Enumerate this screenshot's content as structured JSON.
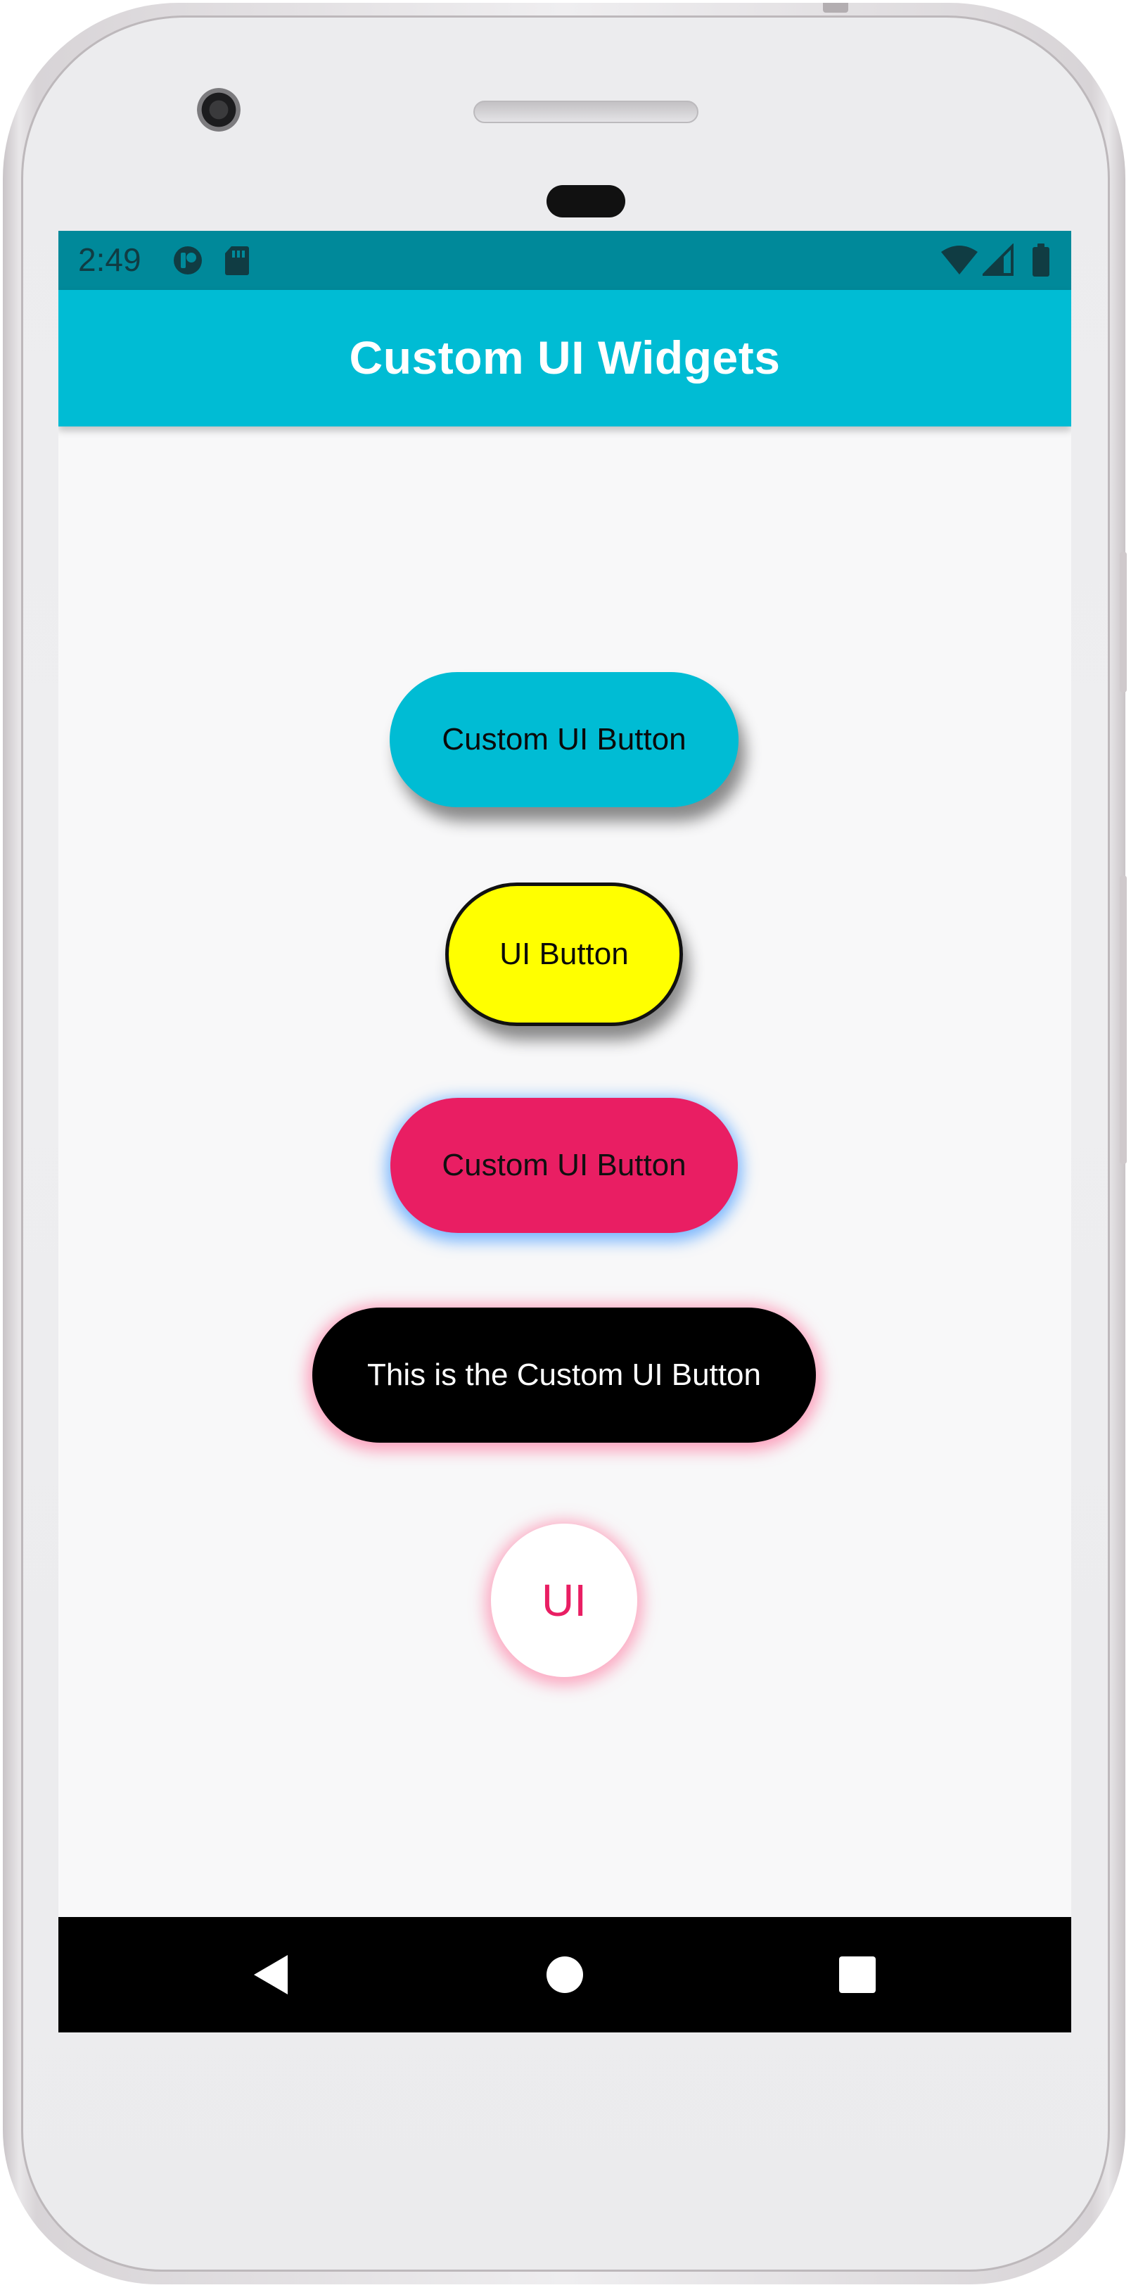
{
  "status_bar": {
    "time": "2:49",
    "icons_left": [
      "app-notification-icon",
      "sd-card-icon"
    ],
    "icons_right": [
      "wifi-icon",
      "cellular-signal-icon",
      "battery-icon"
    ],
    "color": "#00899a"
  },
  "app_bar": {
    "title": "Custom UI Widgets",
    "color": "#00bcd4"
  },
  "buttons": [
    {
      "label": "Custom UI Button",
      "color": "#00bcd4",
      "text_color": "#000000",
      "shadow": "dark"
    },
    {
      "label": "UI Button",
      "color": "#ffff00",
      "text_color": "#000000",
      "border": "#000000",
      "shadow": "dark"
    },
    {
      "label": "Custom UI Button",
      "color": "#e91e63",
      "text_color": "#000000",
      "shadow": "blue-glow"
    },
    {
      "label": "This is the Custom UI Button",
      "color": "#000000",
      "text_color": "#ffffff",
      "shadow": "pink-glow"
    },
    {
      "label": "UI",
      "color": "#ffffff",
      "text_color": "#e91e63",
      "shape": "circle",
      "shadow": "pink-glow"
    }
  ],
  "nav_bar": {
    "icons": [
      "back-icon",
      "home-icon",
      "recent-apps-icon"
    ]
  }
}
